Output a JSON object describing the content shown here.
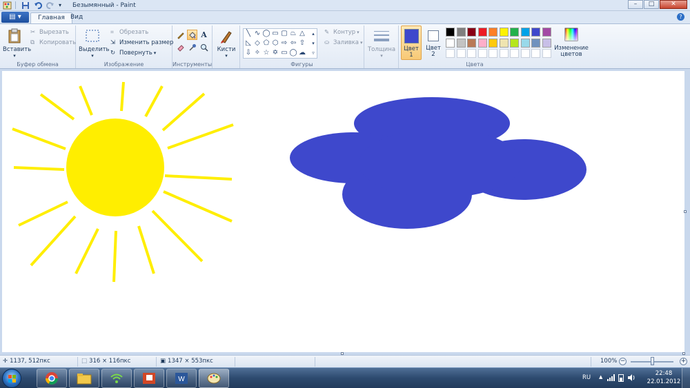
{
  "window": {
    "title": "Безымянный - Paint",
    "controls": {
      "minimize": "–",
      "maximize": "□",
      "close": "✕"
    }
  },
  "tabs": [
    {
      "label": "Главная",
      "active": true
    },
    {
      "label": "Вид",
      "active": false
    }
  ],
  "ribbon": {
    "clipboard": {
      "group_label": "Буфер обмена",
      "paste_label": "Вставить",
      "cut_label": "Вырезать",
      "copy_label": "Копировать"
    },
    "image": {
      "group_label": "Изображение",
      "select_label": "Выделить",
      "crop_label": "Обрезать",
      "resize_label": "Изменить размер",
      "rotate_label": "Повернуть"
    },
    "tools": {
      "group_label": "Инструменты",
      "active_tool": "fill-icon"
    },
    "brushes": {
      "label": "Кисти"
    },
    "shapes": {
      "group_label": "Фигуры",
      "outline_label": "Контур",
      "fill_label": "Заливка"
    },
    "size": {
      "label": "Толщина"
    },
    "colors": {
      "group_label": "Цвета",
      "color1_label": "Цвет",
      "color1_num": "1",
      "color2_label": "Цвет",
      "color2_num": "2",
      "color1": "#3e48cc",
      "color2": "#ffffff",
      "edit_label": "Изменение",
      "edit_label2": "цветов",
      "palette_row1": [
        "#000000",
        "#7f7f7f",
        "#880015",
        "#ed1c24",
        "#ff7f27",
        "#fff200",
        "#22b14c",
        "#00a2e8",
        "#3f48cc",
        "#a349a4"
      ],
      "palette_row2": [
        "#ffffff",
        "#c3c3c3",
        "#b97a57",
        "#ffaec9",
        "#ffc90e",
        "#efe4b0",
        "#b5e61d",
        "#99d9ea",
        "#7092be",
        "#c8bfe7"
      ],
      "palette_row3": [
        "#ffffff",
        "#ffffff",
        "#ffffff",
        "#ffffff",
        "#ffffff",
        "#ffffff",
        "#ffffff",
        "#ffffff",
        "#ffffff",
        "#ffffff"
      ]
    }
  },
  "canvas": {
    "sun_color": "#ffee00",
    "cloud_color": "#3e48cc"
  },
  "status": {
    "cursor_pos": "1137, 512пкс",
    "selection_size": "316 × 116пкс",
    "image_size": "1347 × 553пкс",
    "zoom": "100%"
  },
  "taskbar": {
    "lang": "RU",
    "time": "22:48",
    "date": "22.01.2012"
  }
}
